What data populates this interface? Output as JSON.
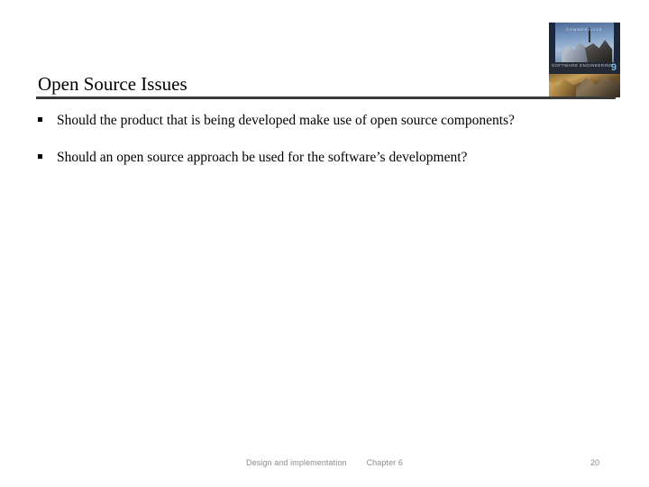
{
  "slide": {
    "title": "Open Source Issues",
    "bullets": [
      {
        "marker": "square-bullet",
        "text": "Should the product that is being developed make use of open source components?",
        "align": "left"
      },
      {
        "marker": "square-bullet",
        "text": "Should an open source approach be used for the software’s development?",
        "align": "justify"
      }
    ],
    "footer": {
      "topic": "Design and implementation",
      "chapter": "Chapter 6",
      "page_number": "20"
    },
    "cover": {
      "author": "SOMMERVILLE",
      "title": "SOFTWARE ENGINEERING",
      "edition": "9"
    },
    "colors": {
      "rule": "#3a3a3a",
      "text": "#000000",
      "footer_text": "#8c8c8c",
      "background": "#ffffff",
      "cover_band": "#232a33",
      "cover_edition": "#7fb8e6"
    }
  }
}
